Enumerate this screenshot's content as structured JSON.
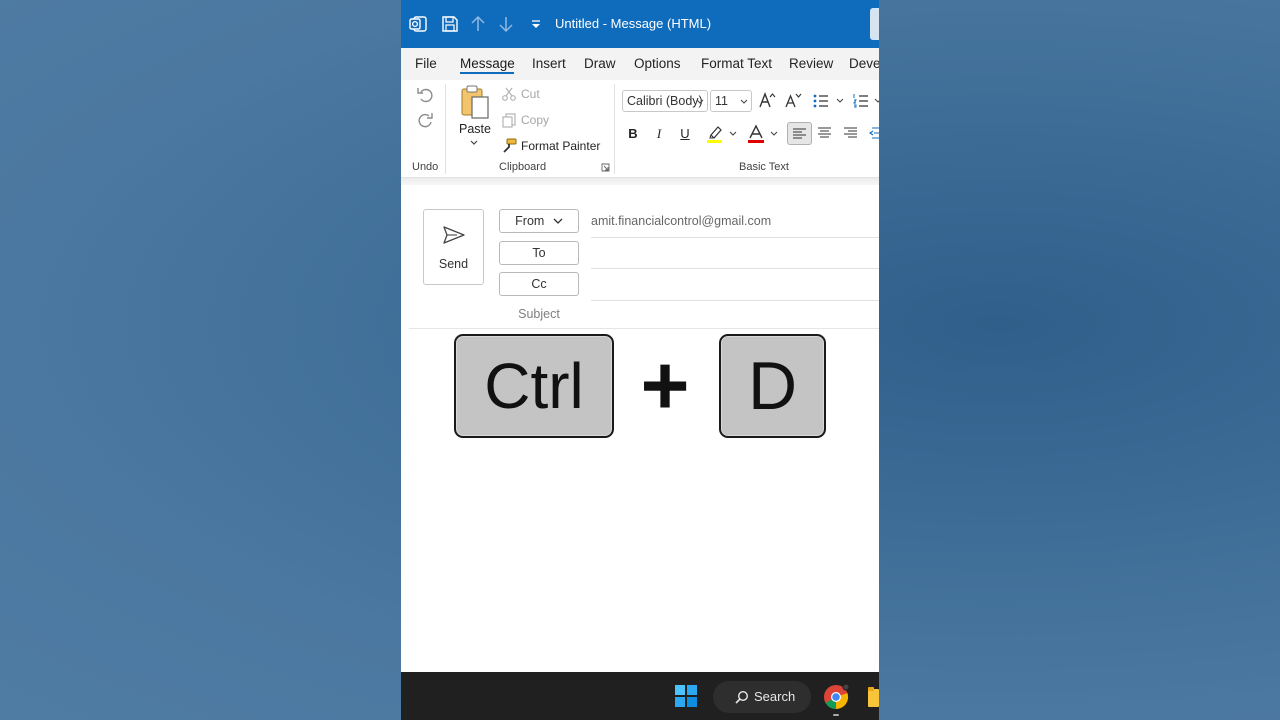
{
  "titlebar": {
    "title": "Untitled  -  Message (HTML)",
    "icons": [
      "outlook-icon",
      "save-icon",
      "up-arrow-icon",
      "down-arrow-icon",
      "customize-toolbar-icon"
    ]
  },
  "menu": {
    "items": [
      "File",
      "Message",
      "Insert",
      "Draw",
      "Options",
      "Format Text",
      "Review",
      "Deve"
    ],
    "active": "Message"
  },
  "ribbon": {
    "undo_group": "Undo",
    "clipboard": {
      "paste": "Paste",
      "cut": "Cut",
      "copy": "Copy",
      "format_painter": "Format Painter",
      "group_label": "Clipboard"
    },
    "basic_text": {
      "font": "Calibri (Body)",
      "size": "11",
      "bold": "B",
      "italic": "I",
      "underline": "U",
      "group_label": "Basic Text"
    }
  },
  "compose": {
    "send": "Send",
    "from_label": "From",
    "from_value": "amit.financialcontrol@gmail.com",
    "to_label": "To",
    "cc_label": "Cc",
    "subject_label": "Subject"
  },
  "overlay": {
    "key1": "Ctrl",
    "plus": "+",
    "key2": "D"
  },
  "taskbar": {
    "search": "Search"
  },
  "colors": {
    "accent": "#0f6cbd",
    "highlight": "#ffff00",
    "font_color": "#e00000",
    "taskbar": "#202020"
  }
}
